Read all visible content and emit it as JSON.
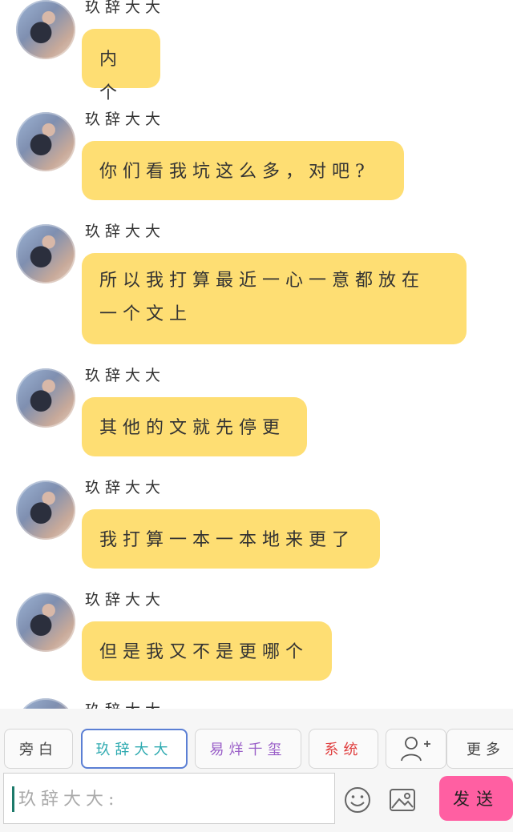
{
  "messages": [
    {
      "sender": "玖辞大大",
      "text": "内个"
    },
    {
      "sender": "玖辞大大",
      "text": "你们看我坑这么多，对吧?"
    },
    {
      "sender": "玖辞大大",
      "text_line1": "所以我打算最近一心一意都放在",
      "text_line2": "一个文上"
    },
    {
      "sender": "玖辞大大",
      "text": "其他的文就先停更"
    },
    {
      "sender": "玖辞大大",
      "text": "我打算一本一本地来更了"
    },
    {
      "sender": "玖辞大大",
      "text": "但是我又不是更哪个"
    },
    {
      "sender": "玖辞大大"
    }
  ],
  "toolbar": {
    "roles": [
      "旁白",
      "玖辞大大",
      "易烊千玺",
      "系统"
    ],
    "add_role_icon": "add-user-icon",
    "more_label": "更多",
    "input_placeholder": "玖辞大大:",
    "emoji_icon": "smiley-icon",
    "image_icon": "image-icon",
    "send_label": "发送"
  },
  "colors": {
    "bubble": "#fede73",
    "send_button": "#ff5fa2",
    "active_chip_border": "#5b7fd4",
    "active_chip_text": "#2eaab0",
    "role_purple": "#9a5fc8",
    "role_red": "#e04040"
  }
}
